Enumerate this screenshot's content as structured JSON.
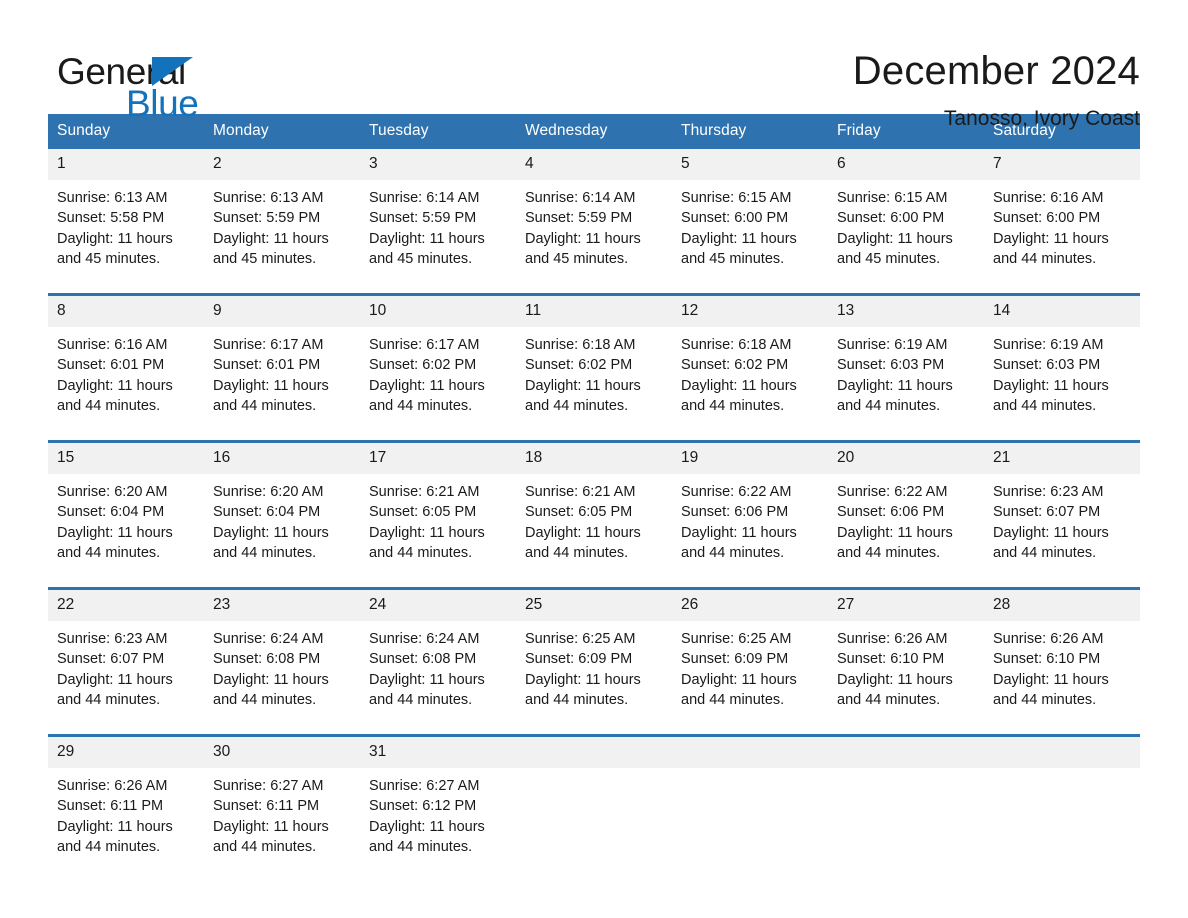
{
  "brand": {
    "name_part1": "General",
    "name_part2": "Blue",
    "triangle_color": "#1272bc"
  },
  "header": {
    "title": "December 2024",
    "subtitle": "Tanosso, Ivory Coast"
  },
  "theme": {
    "header_blue": "#2e73b0",
    "date_band": "#f1f1f1",
    "text": "#1a1a1a"
  },
  "calendar": {
    "weekday_headers": [
      "Sunday",
      "Monday",
      "Tuesday",
      "Wednesday",
      "Thursday",
      "Friday",
      "Saturday"
    ],
    "weeks": [
      [
        {
          "day": "1",
          "sunrise": "Sunrise: 6:13 AM",
          "sunset": "Sunset: 5:58 PM",
          "daylight": "Daylight: 11 hours and 45 minutes."
        },
        {
          "day": "2",
          "sunrise": "Sunrise: 6:13 AM",
          "sunset": "Sunset: 5:59 PM",
          "daylight": "Daylight: 11 hours and 45 minutes."
        },
        {
          "day": "3",
          "sunrise": "Sunrise: 6:14 AM",
          "sunset": "Sunset: 5:59 PM",
          "daylight": "Daylight: 11 hours and 45 minutes."
        },
        {
          "day": "4",
          "sunrise": "Sunrise: 6:14 AM",
          "sunset": "Sunset: 5:59 PM",
          "daylight": "Daylight: 11 hours and 45 minutes."
        },
        {
          "day": "5",
          "sunrise": "Sunrise: 6:15 AM",
          "sunset": "Sunset: 6:00 PM",
          "daylight": "Daylight: 11 hours and 45 minutes."
        },
        {
          "day": "6",
          "sunrise": "Sunrise: 6:15 AM",
          "sunset": "Sunset: 6:00 PM",
          "daylight": "Daylight: 11 hours and 45 minutes."
        },
        {
          "day": "7",
          "sunrise": "Sunrise: 6:16 AM",
          "sunset": "Sunset: 6:00 PM",
          "daylight": "Daylight: 11 hours and 44 minutes."
        }
      ],
      [
        {
          "day": "8",
          "sunrise": "Sunrise: 6:16 AM",
          "sunset": "Sunset: 6:01 PM",
          "daylight": "Daylight: 11 hours and 44 minutes."
        },
        {
          "day": "9",
          "sunrise": "Sunrise: 6:17 AM",
          "sunset": "Sunset: 6:01 PM",
          "daylight": "Daylight: 11 hours and 44 minutes."
        },
        {
          "day": "10",
          "sunrise": "Sunrise: 6:17 AM",
          "sunset": "Sunset: 6:02 PM",
          "daylight": "Daylight: 11 hours and 44 minutes."
        },
        {
          "day": "11",
          "sunrise": "Sunrise: 6:18 AM",
          "sunset": "Sunset: 6:02 PM",
          "daylight": "Daylight: 11 hours and 44 minutes."
        },
        {
          "day": "12",
          "sunrise": "Sunrise: 6:18 AM",
          "sunset": "Sunset: 6:02 PM",
          "daylight": "Daylight: 11 hours and 44 minutes."
        },
        {
          "day": "13",
          "sunrise": "Sunrise: 6:19 AM",
          "sunset": "Sunset: 6:03 PM",
          "daylight": "Daylight: 11 hours and 44 minutes."
        },
        {
          "day": "14",
          "sunrise": "Sunrise: 6:19 AM",
          "sunset": "Sunset: 6:03 PM",
          "daylight": "Daylight: 11 hours and 44 minutes."
        }
      ],
      [
        {
          "day": "15",
          "sunrise": "Sunrise: 6:20 AM",
          "sunset": "Sunset: 6:04 PM",
          "daylight": "Daylight: 11 hours and 44 minutes."
        },
        {
          "day": "16",
          "sunrise": "Sunrise: 6:20 AM",
          "sunset": "Sunset: 6:04 PM",
          "daylight": "Daylight: 11 hours and 44 minutes."
        },
        {
          "day": "17",
          "sunrise": "Sunrise: 6:21 AM",
          "sunset": "Sunset: 6:05 PM",
          "daylight": "Daylight: 11 hours and 44 minutes."
        },
        {
          "day": "18",
          "sunrise": "Sunrise: 6:21 AM",
          "sunset": "Sunset: 6:05 PM",
          "daylight": "Daylight: 11 hours and 44 minutes."
        },
        {
          "day": "19",
          "sunrise": "Sunrise: 6:22 AM",
          "sunset": "Sunset: 6:06 PM",
          "daylight": "Daylight: 11 hours and 44 minutes."
        },
        {
          "day": "20",
          "sunrise": "Sunrise: 6:22 AM",
          "sunset": "Sunset: 6:06 PM",
          "daylight": "Daylight: 11 hours and 44 minutes."
        },
        {
          "day": "21",
          "sunrise": "Sunrise: 6:23 AM",
          "sunset": "Sunset: 6:07 PM",
          "daylight": "Daylight: 11 hours and 44 minutes."
        }
      ],
      [
        {
          "day": "22",
          "sunrise": "Sunrise: 6:23 AM",
          "sunset": "Sunset: 6:07 PM",
          "daylight": "Daylight: 11 hours and 44 minutes."
        },
        {
          "day": "23",
          "sunrise": "Sunrise: 6:24 AM",
          "sunset": "Sunset: 6:08 PM",
          "daylight": "Daylight: 11 hours and 44 minutes."
        },
        {
          "day": "24",
          "sunrise": "Sunrise: 6:24 AM",
          "sunset": "Sunset: 6:08 PM",
          "daylight": "Daylight: 11 hours and 44 minutes."
        },
        {
          "day": "25",
          "sunrise": "Sunrise: 6:25 AM",
          "sunset": "Sunset: 6:09 PM",
          "daylight": "Daylight: 11 hours and 44 minutes."
        },
        {
          "day": "26",
          "sunrise": "Sunrise: 6:25 AM",
          "sunset": "Sunset: 6:09 PM",
          "daylight": "Daylight: 11 hours and 44 minutes."
        },
        {
          "day": "27",
          "sunrise": "Sunrise: 6:26 AM",
          "sunset": "Sunset: 6:10 PM",
          "daylight": "Daylight: 11 hours and 44 minutes."
        },
        {
          "day": "28",
          "sunrise": "Sunrise: 6:26 AM",
          "sunset": "Sunset: 6:10 PM",
          "daylight": "Daylight: 11 hours and 44 minutes."
        }
      ],
      [
        {
          "day": "29",
          "sunrise": "Sunrise: 6:26 AM",
          "sunset": "Sunset: 6:11 PM",
          "daylight": "Daylight: 11 hours and 44 minutes."
        },
        {
          "day": "30",
          "sunrise": "Sunrise: 6:27 AM",
          "sunset": "Sunset: 6:11 PM",
          "daylight": "Daylight: 11 hours and 44 minutes."
        },
        {
          "day": "31",
          "sunrise": "Sunrise: 6:27 AM",
          "sunset": "Sunset: 6:12 PM",
          "daylight": "Daylight: 11 hours and 44 minutes."
        },
        {
          "day": "",
          "sunrise": "",
          "sunset": "",
          "daylight": ""
        },
        {
          "day": "",
          "sunrise": "",
          "sunset": "",
          "daylight": ""
        },
        {
          "day": "",
          "sunrise": "",
          "sunset": "",
          "daylight": ""
        },
        {
          "day": "",
          "sunrise": "",
          "sunset": "",
          "daylight": ""
        }
      ]
    ]
  }
}
